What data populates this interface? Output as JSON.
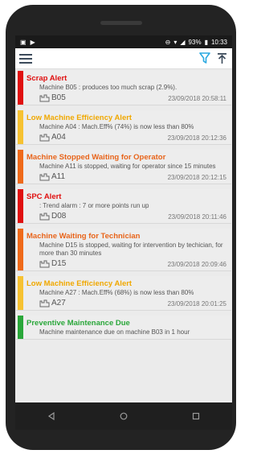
{
  "status": {
    "battery": "93%",
    "time": "10:33"
  },
  "colors": {
    "red": "#e01010",
    "yellow": "#f6c232",
    "orange": "#ef6a1a",
    "green": "#2aa73a",
    "accent_blue": "#29a8e0"
  },
  "alerts": [
    {
      "title": "Scrap Alert",
      "title_color": "#e01010",
      "bar_color": "#e01010",
      "message": "Machine B05 : produces too much scrap (2.9%).",
      "machine": "B05",
      "time": "23/09/2018 20:58:11"
    },
    {
      "title": "Low Machine Efficiency Alert",
      "title_color": "#f0a800",
      "bar_color": "#f6c232",
      "message": "Machine A04 : Mach.Eff% (74%) is now less than 80%",
      "machine": "A04",
      "time": "23/09/2018 20:12:36"
    },
    {
      "title": "Machine Stopped Waiting for Operator",
      "title_color": "#e8641a",
      "bar_color": "#ef6a1a",
      "message": "Machine A11 is stopped, waiting for operator since 15 minutes",
      "machine": "A11",
      "time": "23/09/2018 20:12:15"
    },
    {
      "title": "SPC Alert",
      "title_color": "#e01010",
      "bar_color": "#e01010",
      "message": ": Trend alarm : 7 or more points run up",
      "machine": "D08",
      "time": "23/09/2018 20:11:46"
    },
    {
      "title": "Machine Waiting for Technician",
      "title_color": "#e8641a",
      "bar_color": "#ef6a1a",
      "message": "Machine D15 is stopped, waiting for intervention by techician, for more than 30 minutes",
      "machine": "D15",
      "time": "23/09/2018 20:09:46"
    },
    {
      "title": "Low Machine Efficiency Alert",
      "title_color": "#f0a800",
      "bar_color": "#f6c232",
      "message": "Machine A27 : Mach.Eff% (68%) is now less than 80%",
      "machine": "A27",
      "time": "23/09/2018 20:01:25"
    },
    {
      "title": "Preventive Maintenance Due",
      "title_color": "#2aa73a",
      "bar_color": "#2aa73a",
      "message": "Machine maintenance due on machine B03 in 1 hour",
      "machine": "",
      "time": ""
    }
  ]
}
